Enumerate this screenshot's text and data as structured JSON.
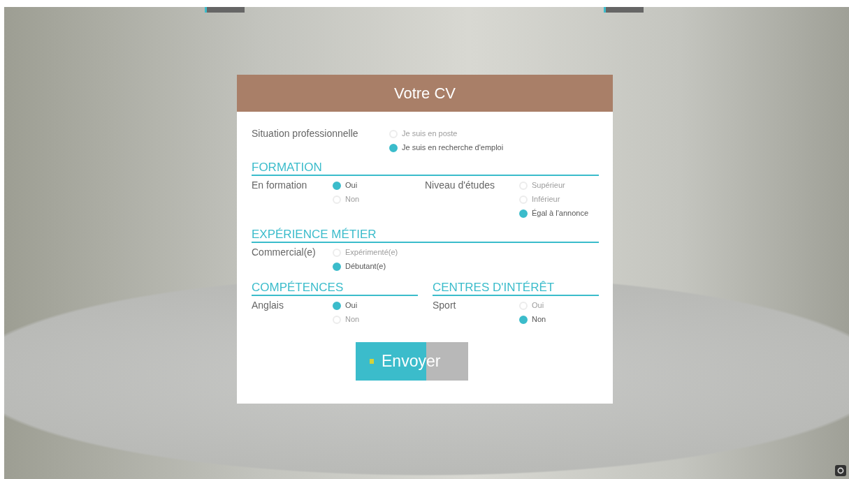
{
  "dialog": {
    "title": "Votre CV",
    "situation": {
      "label": "Situation professionnelle",
      "options": [
        {
          "label": "Je suis en poste",
          "selected": false
        },
        {
          "label": "Je suis en recherche d'emploi",
          "selected": true
        }
      ]
    },
    "sections": [
      {
        "title": "FORMATION",
        "kind": "full",
        "groups": [
          {
            "label": "En formation",
            "options": [
              {
                "label": "Oui",
                "selected": true
              },
              {
                "label": "Non",
                "selected": false
              }
            ]
          },
          {
            "label": "Niveau d'études",
            "options": [
              {
                "label": "Supérieur",
                "selected": false
              },
              {
                "label": "Inférieur",
                "selected": false
              },
              {
                "label": "Égal à l'annonce",
                "selected": true
              }
            ]
          }
        ]
      },
      {
        "title": "EXPÉRIENCE MÉTIER",
        "kind": "full",
        "groups": [
          {
            "label": "Commercial(e)",
            "options": [
              {
                "label": "Expérimenté(e)",
                "selected": false
              },
              {
                "label": "Débutant(e)",
                "selected": true
              }
            ]
          }
        ]
      },
      {
        "title": "COMPÉTENCES",
        "kind": "half",
        "groups": [
          {
            "label": "Anglais",
            "options": [
              {
                "label": "Oui",
                "selected": true
              },
              {
                "label": "Non",
                "selected": false
              }
            ]
          }
        ]
      },
      {
        "title": "CENTRES D'INTÉRÊT",
        "kind": "half",
        "groups": [
          {
            "label": "Sport",
            "options": [
              {
                "label": "Oui",
                "selected": false
              },
              {
                "label": "Non",
                "selected": true
              }
            ]
          }
        ]
      }
    ],
    "submit": {
      "label": "Envoyer",
      "level": 0.63
    }
  }
}
